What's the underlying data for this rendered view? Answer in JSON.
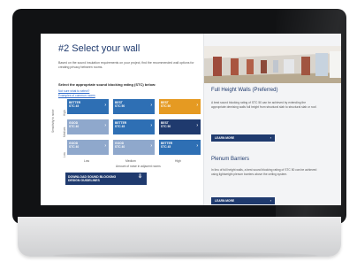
{
  "page": {
    "heading": "#2 Select your wall",
    "intro": "Based on the sound insulation requirements on your project, find the recommended wall options for creating privacy between rooms.",
    "select_label": "Select the appropriate sound blocking rating (STC) below:",
    "links": [
      "Not sure what to select?",
      "Examples of common rooms"
    ]
  },
  "grid": {
    "y_axis_title": "Sensitivity to noise",
    "y_ticks": [
      "High",
      "Medium",
      "Low"
    ],
    "x_ticks": [
      "Low",
      "Medium",
      "High"
    ],
    "x_axis_title": "Amount of noise in adjacent rooms",
    "rows": [
      [
        {
          "label_1": "BETTER",
          "label_2": "STC 45",
          "color": "#2e6fb4"
        },
        {
          "label_1": "BEST",
          "label_2": "STC 50",
          "color": "#2e6fb4"
        },
        {
          "label_1": "BEST",
          "label_2": "STC 50",
          "color": "#e59a22"
        }
      ],
      [
        {
          "label_1": "GOOD",
          "label_2": "STC 40",
          "color": "#8fa8cc"
        },
        {
          "label_1": "BETTER",
          "label_2": "STC 45",
          "color": "#2e6fb4"
        },
        {
          "label_1": "BEST",
          "label_2": "STC 50",
          "color": "#1f3a6e"
        }
      ],
      [
        {
          "label_1": "GOOD",
          "label_2": "STC 40",
          "color": "#8fa8cc"
        },
        {
          "label_1": "GOOD",
          "label_2": "STC 40",
          "color": "#8fa8cc"
        },
        {
          "label_1": "BETTER",
          "label_2": "STC 45",
          "color": "#2e6fb4"
        }
      ]
    ]
  },
  "download_button": {
    "line_1": "DOWNLOAD SOUND BLOCKING",
    "line_2": "DESIGN GUIDELINES",
    "icon": "download-icon"
  },
  "panel": {
    "title_1": "Full Height Walls (Preferred)",
    "text_1": "A best sound blocking rating of STC 50 can be achieved by extending the appropriate demising walls full height from structural slab to structural slab or roof.",
    "button_1": "LEARN MORE",
    "title_2": "Plenum Barriers",
    "text_2": "In lieu of full height walls, a best sound blocking rating of STC 50 can be achieved using lightweight plenum barriers above the ceiling system.",
    "button_2": "LEARN MORE"
  },
  "colors": {
    "accent_navy": "#1f3a6e",
    "accent_blue": "#2e6fb4",
    "accent_light": "#8fa8cc",
    "accent_orange": "#e59a22"
  }
}
